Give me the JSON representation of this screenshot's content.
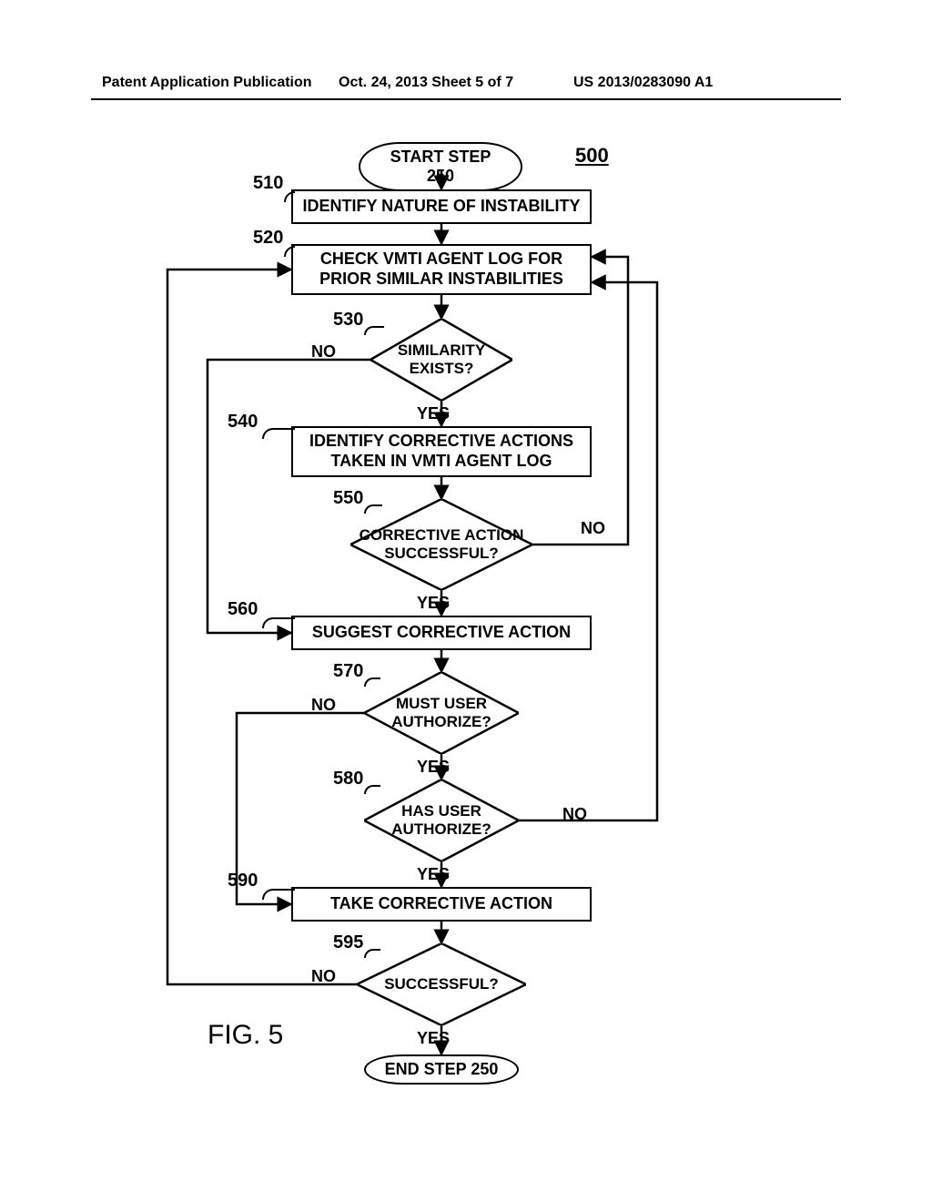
{
  "header": {
    "left": "Patent Application Publication",
    "center": "Oct. 24, 2013  Sheet 5 of 7",
    "right": "US 2013/0283090 A1"
  },
  "diagram": {
    "number": "500",
    "figure_label": "FIG. 5",
    "start": "START STEP 250",
    "end": "END STEP 250",
    "refs": {
      "r510": "510",
      "r520": "520",
      "r530": "530",
      "r540": "540",
      "r550": "550",
      "r560": "560",
      "r570": "570",
      "r580": "580",
      "r590": "590",
      "r595": "595"
    },
    "nodes": {
      "n510": "IDENTIFY NATURE OF INSTABILITY",
      "n520": "CHECK VMTI AGENT LOG FOR PRIOR SIMILAR INSTABILITIES",
      "n530": "SIMILARITY EXISTS?",
      "n540": "IDENTIFY CORRECTIVE ACTIONS TAKEN IN VMTI AGENT LOG",
      "n550": "CORRECTIVE ACTION SUCCESSFUL?",
      "n560": "SUGGEST CORRECTIVE ACTION",
      "n570": "MUST USER AUTHORIZE?",
      "n580": "HAS USER AUTHORIZE?",
      "n590": "TAKE CORRECTIVE ACTION",
      "n595": "SUCCESSFUL?"
    },
    "labels": {
      "yes": "YES",
      "no": "NO"
    }
  }
}
